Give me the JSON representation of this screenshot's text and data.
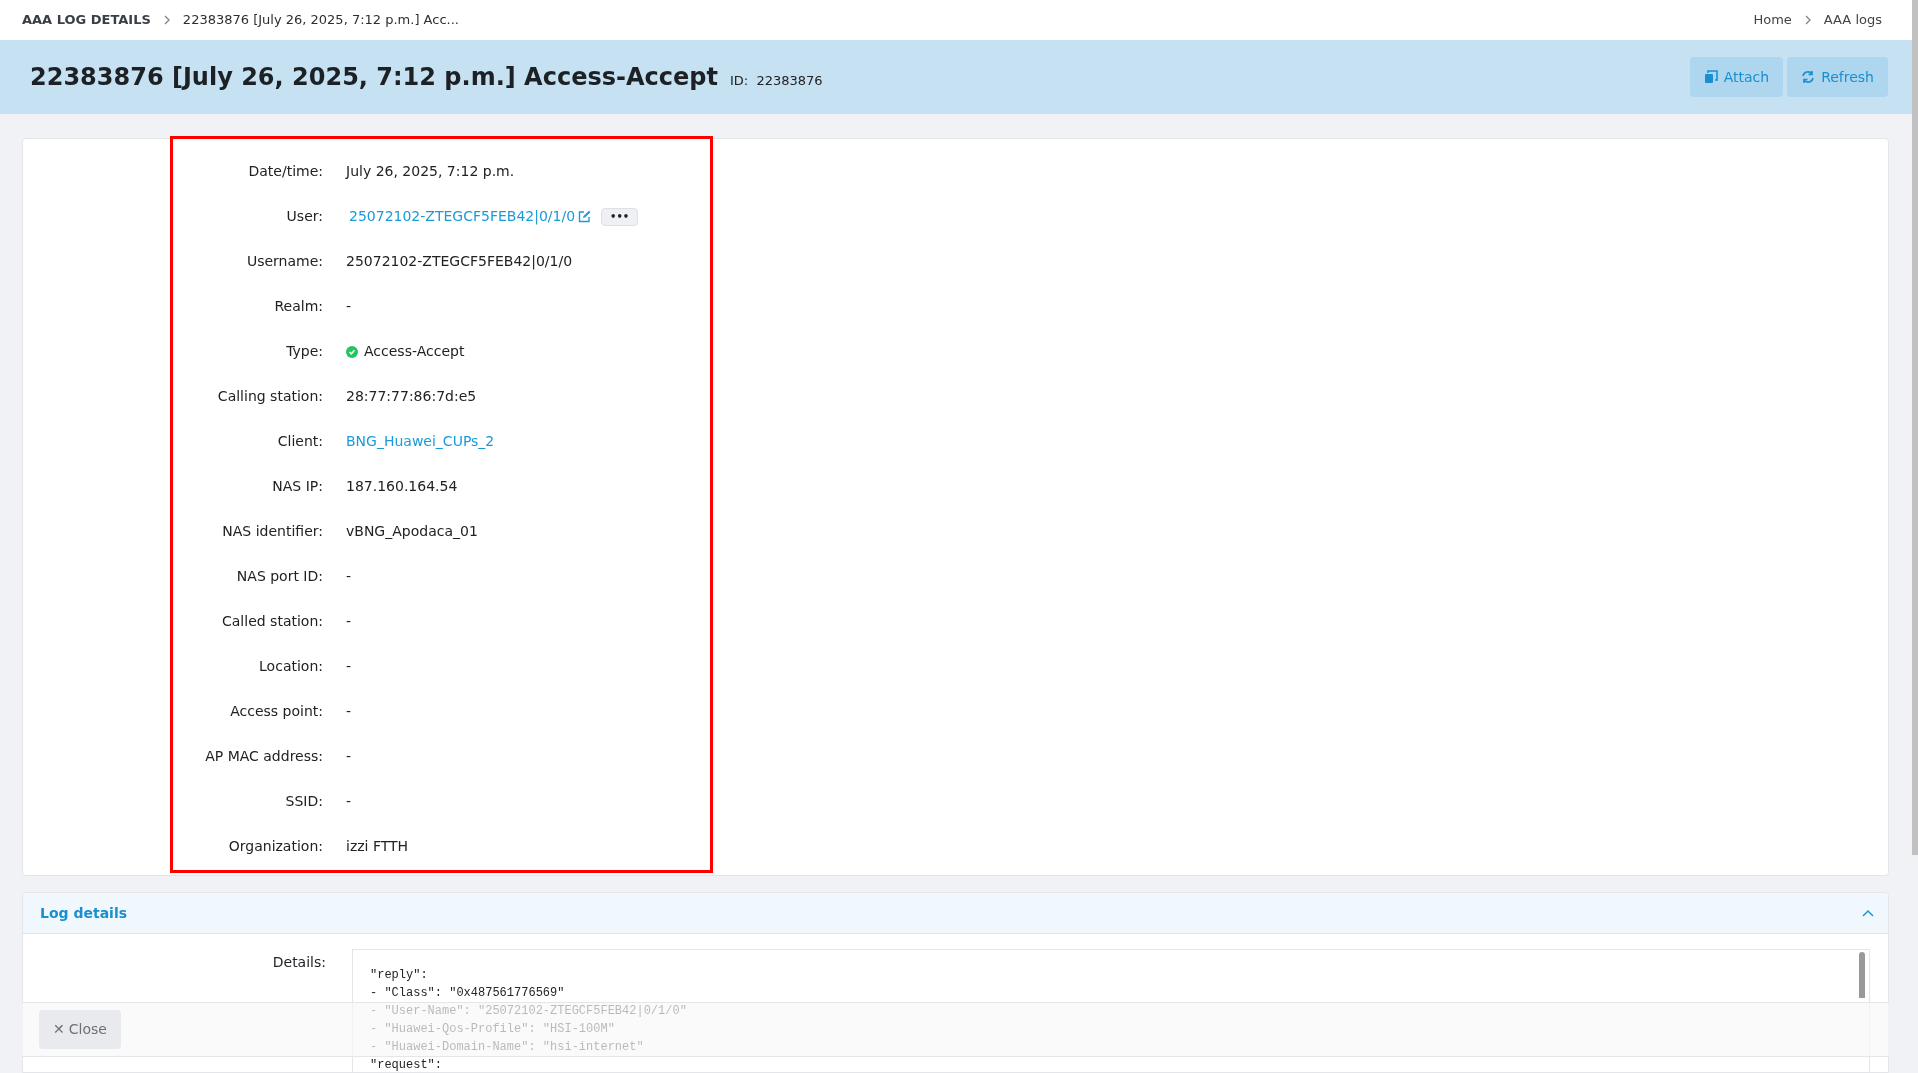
{
  "breadcrumb": {
    "section": "AAA LOG DETAILS",
    "current": "22383876 [July 26, 2025, 7:12 p.m.] Acc...",
    "links": [
      "Home",
      "AAA logs"
    ]
  },
  "header": {
    "title": "22383876 [July 26, 2025, 7:12 p.m.] Access-Accept",
    "id_label": "ID:",
    "id_value": "22383876",
    "buttons": [
      {
        "kind": "attach",
        "label": "Attach"
      },
      {
        "kind": "refresh",
        "label": "Refresh"
      }
    ]
  },
  "fields": [
    {
      "kind": "text",
      "label": "Date/time:",
      "value": "July 26, 2025, 7:12 p.m."
    },
    {
      "kind": "user",
      "label": "User:",
      "value": "25072102-ZTEGCF5FEB42|0/1/0",
      "more": "•••"
    },
    {
      "kind": "text",
      "label": "Username:",
      "value": "25072102-ZTEGCF5FEB42|0/1/0"
    },
    {
      "kind": "text",
      "label": "Realm:",
      "value": "-"
    },
    {
      "kind": "status",
      "label": "Type:",
      "value": "Access-Accept",
      "color": "#22c55e"
    },
    {
      "kind": "text",
      "label": "Calling station:",
      "value": "28:77:77:86:7d:e5"
    },
    {
      "kind": "link",
      "label": "Client:",
      "value": "BNG_Huawei_CUPs_2"
    },
    {
      "kind": "text",
      "label": "NAS IP:",
      "value": "187.160.164.54"
    },
    {
      "kind": "text",
      "label": "NAS identifier:",
      "value": "vBNG_Apodaca_01"
    },
    {
      "kind": "text",
      "label": "NAS port ID:",
      "value": "-"
    },
    {
      "kind": "text",
      "label": "Called station:",
      "value": "-"
    },
    {
      "kind": "text",
      "label": "Location:",
      "value": "-"
    },
    {
      "kind": "text",
      "label": "Access point:",
      "value": "-"
    },
    {
      "kind": "text",
      "label": "AP MAC address:",
      "value": "-"
    },
    {
      "kind": "text",
      "label": "SSID:",
      "value": "-"
    },
    {
      "kind": "text",
      "label": "Organization:",
      "value": "izzi FTTH"
    }
  ],
  "log_details": {
    "title": "Log details",
    "expanded": true,
    "label": "Details:",
    "lines": [
      "\"reply\":",
      "- \"Class\": \"0x487561776569\"",
      "- \"User-Name\": \"25072102-ZTEGCF5FEB42|0/1/0\"",
      "- \"Huawei-Qos-Profile\": \"HSI-100M\"",
      "- \"Huawei-Domain-Name\": \"hsi-internet\"",
      "\"request\":"
    ]
  },
  "footer": {
    "close": "Close",
    "close_icon": "✕"
  }
}
